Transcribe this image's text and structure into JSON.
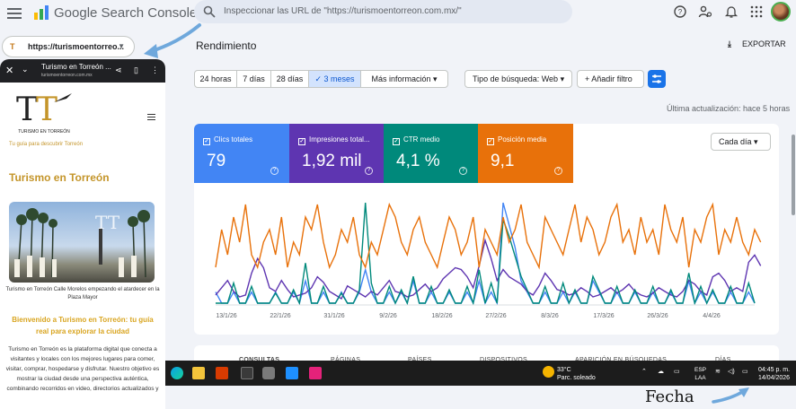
{
  "app": {
    "title": "Google Search Console",
    "search_placeholder": "Inspeccionar las URL de \"https://turismoentorreon.com.mx/\""
  },
  "top_icons": [
    "help-icon",
    "manage-users-icon",
    "notifications-icon",
    "apps-icon"
  ],
  "property": {
    "label": "https://turismoentorreo..."
  },
  "phone": {
    "tab_title": "Turismo en Torreón ...",
    "tab_url": "turismoentorreon.com.mx",
    "logo_text": "TURISMO EN TORREÓN",
    "tagline": "Tu guía para descubrir Torreón",
    "heading": "Turismo en Torreón",
    "photo_caption": "Turismo en Torreón Calle Morelos empezando el atardecer en la Plaza Mayor",
    "welcome": "Bienvenido a Turismo en Torreón: tu guía real para explorar la ciudad",
    "body": "Turismo en Torreón es la plataforma digital que conecta a visitantes y locales con los mejores lugares para comer, visitar, comprar, hospedarse y disfrutar. Nuestro objetivo es mostrar la ciudad desde una perspectiva auténtica, combinando recorridos en video, directorios actualizados y"
  },
  "main": {
    "title": "Rendimiento",
    "export_label": "EXPORTAR",
    "ranges": [
      "24 horas",
      "7 días",
      "28 días",
      "3 meses",
      "Más información"
    ],
    "selected_range": "3 meses",
    "search_type": "Tipo de búsqueda: Web",
    "add_filter": "Añadir filtro",
    "last_update": "Última actualización: hace 5 horas",
    "granularity": "Cada día",
    "metrics": [
      {
        "label": "Clics totales",
        "value": "79",
        "color": "#4285f4"
      },
      {
        "label": "Impresiones total...",
        "value": "1,92 mil",
        "color": "#5e35b1"
      },
      {
        "label": "CTR medio",
        "value": "4,1 %",
        "color": "#00897b"
      },
      {
        "label": "Posición media",
        "value": "9,1",
        "color": "#e8710a"
      }
    ],
    "table_tabs": [
      "CONSULTAS",
      "PÁGINAS",
      "PAÍSES",
      "DISPOSITIVOS",
      "APARICIÓN EN BÚSQUEDAS",
      "DÍAS"
    ]
  },
  "chart_data": {
    "type": "line",
    "x_ticks": [
      "13/1/26",
      "22/1/26",
      "31/1/26",
      "9/2/26",
      "18/2/26",
      "27/2/26",
      "8/3/26",
      "17/3/26",
      "26/3/26",
      "4/4/26"
    ],
    "series": [
      {
        "name": "Clics totales",
        "color": "#4285f4",
        "values": [
          1,
          0,
          0,
          1,
          0,
          0,
          1,
          0,
          0,
          0,
          1,
          0,
          0,
          1,
          0,
          2,
          0,
          0,
          1,
          0,
          0,
          1,
          0,
          0,
          1,
          3,
          1,
          0,
          0,
          1,
          0,
          1,
          0,
          2,
          0,
          0,
          1,
          0,
          0,
          1,
          0,
          0,
          1,
          0,
          2,
          0,
          1,
          0,
          9,
          7,
          5,
          2,
          1,
          0,
          0,
          1,
          0,
          0,
          1,
          0,
          1,
          0,
          0,
          2,
          1,
          0,
          0,
          1,
          0,
          0,
          1,
          0,
          0,
          1,
          0,
          0,
          1,
          0,
          0,
          2,
          0,
          1,
          0,
          1,
          0,
          0,
          1,
          0,
          0,
          1,
          0
        ]
      },
      {
        "name": "Impresiones totales",
        "color": "#5e35b1",
        "values": [
          10,
          14,
          18,
          12,
          9,
          10,
          22,
          30,
          25,
          14,
          12,
          18,
          13,
          9,
          10,
          11,
          14,
          20,
          17,
          12,
          10,
          8,
          15,
          13,
          11,
          9,
          12,
          10,
          14,
          18,
          12,
          11,
          9,
          10,
          13,
          16,
          12,
          14,
          19,
          22,
          25,
          24,
          20,
          14,
          26,
          40,
          30,
          18,
          24,
          20,
          18,
          16,
          12,
          10,
          15,
          22,
          18,
          13,
          12,
          10,
          11,
          14,
          12,
          9,
          10,
          12,
          14,
          11,
          13,
          16,
          12,
          10,
          9,
          11,
          14,
          12,
          10,
          9,
          12,
          18,
          16,
          12,
          10,
          20,
          22,
          18,
          12,
          14,
          12,
          28,
          32,
          26
        ]
      },
      {
        "name": "CTR medio",
        "color": "#00897b",
        "values": [
          0,
          0,
          0,
          6,
          0,
          0,
          5,
          0,
          0,
          0,
          3,
          0,
          0,
          4,
          0,
          12,
          0,
          0,
          5,
          0,
          0,
          3,
          0,
          0,
          4,
          30,
          6,
          0,
          0,
          5,
          0,
          4,
          0,
          8,
          0,
          0,
          5,
          0,
          0,
          4,
          0,
          0,
          5,
          0,
          10,
          0,
          6,
          0,
          25,
          20,
          14,
          8,
          4,
          0,
          0,
          5,
          0,
          0,
          6,
          0,
          4,
          0,
          0,
          8,
          4,
          0,
          0,
          5,
          0,
          0,
          4,
          0,
          0,
          5,
          0,
          0,
          4,
          0,
          0,
          9,
          0,
          5,
          0,
          4,
          0,
          0,
          5,
          0,
          0,
          6,
          0
        ]
      },
      {
        "name": "Posición media",
        "color": "#e8710a",
        "values": [
          8,
          11,
          9,
          12,
          10,
          13,
          9,
          8,
          10,
          11,
          9,
          12,
          8,
          10,
          9,
          12,
          11,
          13,
          10,
          8,
          9,
          11,
          10,
          12,
          9,
          8,
          10,
          9,
          11,
          13,
          12,
          10,
          9,
          11,
          12,
          10,
          9,
          8,
          10,
          12,
          11,
          9,
          10,
          12,
          8,
          11,
          10,
          9,
          12,
          10,
          11,
          13,
          10,
          9,
          8,
          12,
          11,
          10,
          9,
          11,
          13,
          10,
          12,
          11,
          9,
          10,
          12,
          13,
          10,
          11,
          9,
          12,
          10,
          11,
          9,
          13,
          11,
          10,
          12,
          8,
          11,
          10,
          12,
          13,
          9,
          11,
          10,
          12,
          10,
          9,
          11,
          10
        ]
      }
    ]
  },
  "taskbar": {
    "temp": "33°C",
    "weather": "Parc. soleado",
    "lang1": "ESP",
    "lang2": "LAA",
    "time": "04:45 p. m.",
    "date": "14/04/2026"
  },
  "annotation": {
    "fecha": "Fecha"
  }
}
